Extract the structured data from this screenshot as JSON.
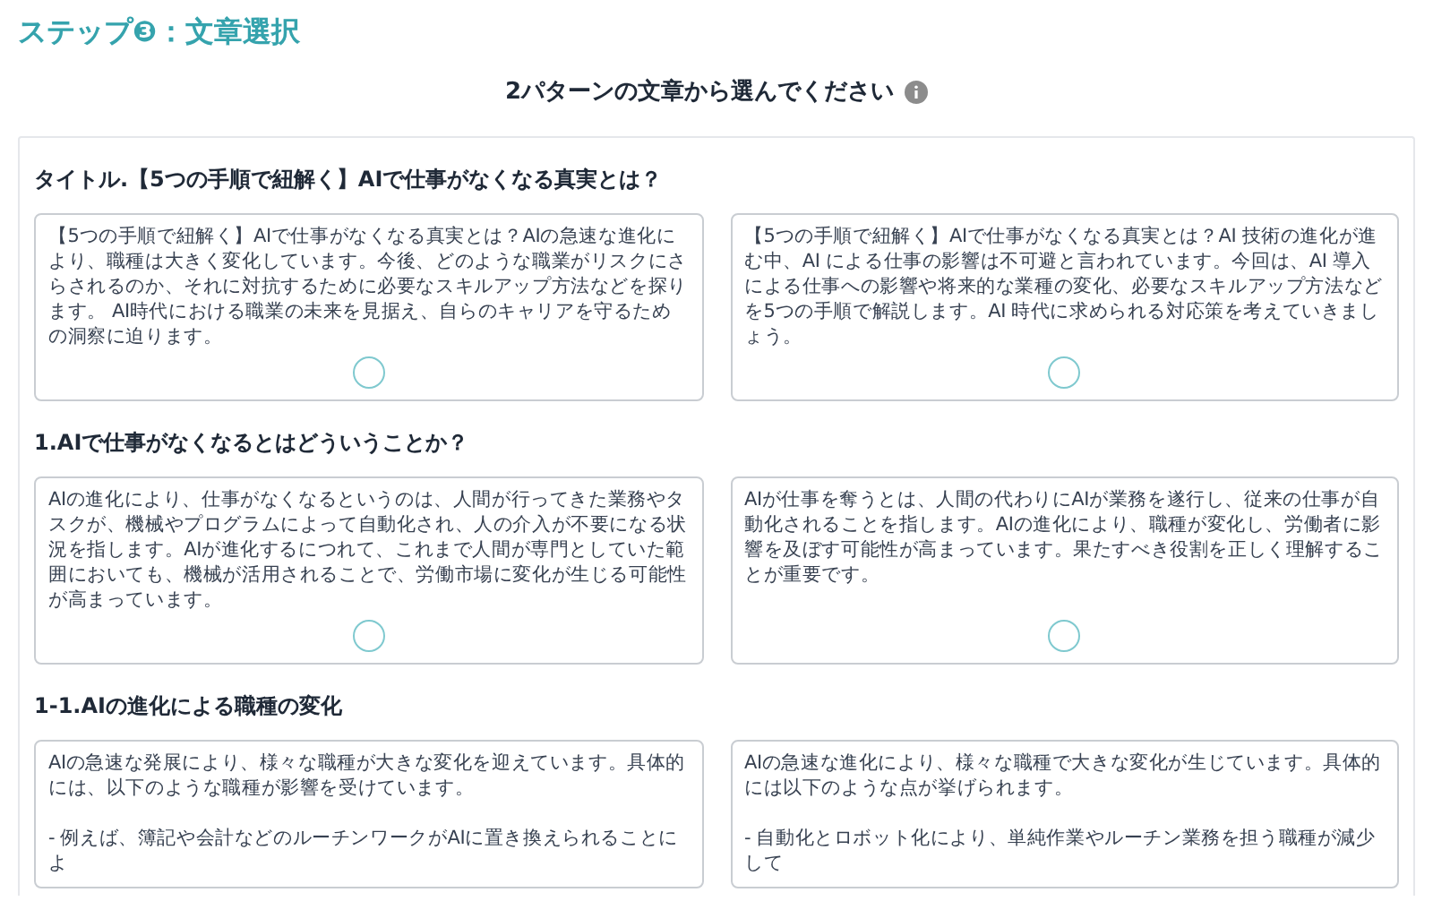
{
  "step_title": "ステップ❸：文章選択",
  "instruction": "2パターンの文章から選んでください",
  "sections": [
    {
      "heading": "タイトル.【5つの手順で紐解く】AIで仕事がなくなる真実とは？",
      "options": [
        {
          "text": "【5つの手順で紐解く】AIで仕事がなくなる真実とは？AIの急速な進化により、職種は大きく変化しています。今後、どのような職業がリスクにさらされるのか、それに対抗するために必要なスキルアップ方法などを探ります。 AI時代における職業の未来を見据え、自らのキャリアを守るための洞察に迫ります。",
          "selected": false
        },
        {
          "text": "【5つの手順で紐解く】AIで仕事がなくなる真実とは？AI 技術の進化が進む中、AI による仕事の影響は不可避と言われています。今回は、AI 導入による仕事への影響や将来的な業種の変化、必要なスキルアップ方法などを5つの手順で解説します。AI 時代に求められる対応策を考えていきましょう。",
          "selected": false
        }
      ]
    },
    {
      "heading": "1.AIで仕事がなくなるとはどういうことか？",
      "options": [
        {
          "text": "AIの進化により、仕事がなくなるというのは、人間が行ってきた業務やタスクが、機械やプログラムによって自動化され、人の介入が不要になる状況を指します。AIが進化するにつれて、これまで人間が専門としていた範囲においても、機械が活用されることで、労働市場に変化が生じる可能性が高まっています。",
          "selected": false
        },
        {
          "text": "AIが仕事を奪うとは、人間の代わりにAIが業務を遂行し、従来の仕事が自動化されることを指します。AIの進化により、職種が変化し、労働者に影響を及ぼす可能性が高まっています。果たすべき役割を正しく理解することが重要です。",
          "selected": false
        }
      ]
    },
    {
      "heading": "1-1.AIの進化による職種の変化",
      "options": [
        {
          "text": "AIの急速な発展により、様々な職種が大きな変化を迎えています。具体的には、以下のような職種が影響を受けています。\n\n- 例えば、簿記や会計などのルーチンワークがAIに置き換えられることによ"
        },
        {
          "text": "AIの急速な進化により、様々な職種で大きな変化が生じています。具体的には以下のような点が挙げられます。\n\n- 自動化とロボット化により、単純作業やルーチン業務を担う職種が減少して"
        }
      ]
    }
  ]
}
